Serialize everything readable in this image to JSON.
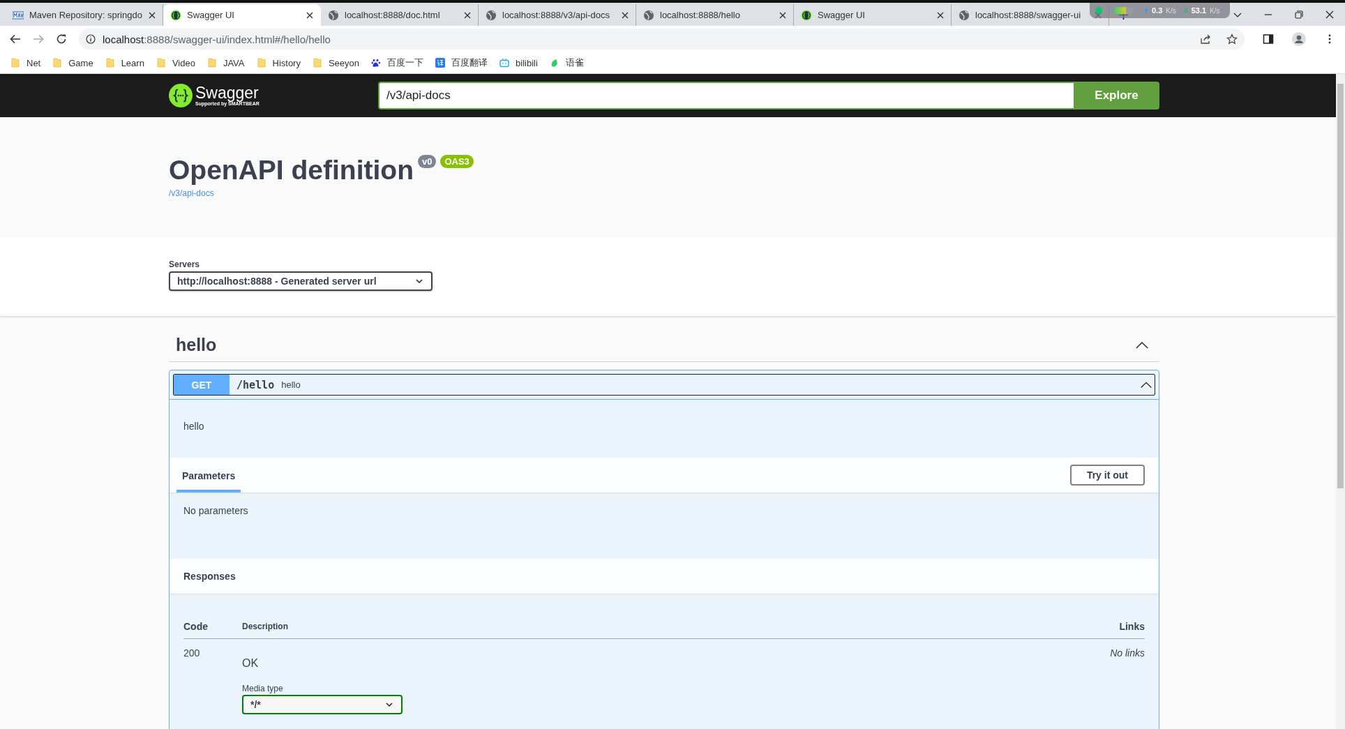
{
  "browser": {
    "tabs": [
      {
        "title": "Maven Repository: springdo",
        "kind": "maven",
        "selected": false
      },
      {
        "title": "Swagger UI",
        "kind": "swagger",
        "selected": true
      },
      {
        "title": "localhost:8888/doc.html",
        "kind": "globe",
        "selected": false
      },
      {
        "title": "localhost:8888/v3/api-docs",
        "kind": "globe",
        "selected": false
      },
      {
        "title": "localhost:8888/hello",
        "kind": "globe",
        "selected": false
      },
      {
        "title": "Swagger UI",
        "kind": "swagger",
        "selected": false
      },
      {
        "title": "localhost:8888/swagger-ui",
        "kind": "globe",
        "selected": false
      }
    ],
    "address_host": "localhost",
    "address_rest": ":8888/swagger-ui/index.html#/hello/hello",
    "bookmarks": [
      {
        "label": "Net",
        "kind": "folder"
      },
      {
        "label": "Game",
        "kind": "folder"
      },
      {
        "label": "Learn",
        "kind": "folder"
      },
      {
        "label": "Video",
        "kind": "folder"
      },
      {
        "label": "JAVA",
        "kind": "folder"
      },
      {
        "label": "History",
        "kind": "folder"
      },
      {
        "label": "Seeyon",
        "kind": "folder"
      },
      {
        "label": "百度一下",
        "kind": "baidu"
      },
      {
        "label": "百度翻译",
        "kind": "translate"
      },
      {
        "label": "bilibili",
        "kind": "bilibili"
      },
      {
        "label": "语雀",
        "kind": "yuque"
      }
    ]
  },
  "net_monitor": {
    "upload": "0.3",
    "upload_unit": "K/s",
    "download": "53.1",
    "download_unit": "K/s"
  },
  "swagger": {
    "logo_text": "Swagger",
    "logo_sub": "Supported by SMARTBEAR",
    "url": "/v3/api-docs",
    "explore": "Explore",
    "title": "OpenAPI definition",
    "version": "v0",
    "oas": "OAS3",
    "spec_link": "/v3/api-docs",
    "servers_label": "Servers",
    "server": "http://localhost:8888 - Generated server url",
    "tags": [
      {
        "name": "hello",
        "expanded": true,
        "operations": [
          {
            "method": "GET",
            "path": "/hello",
            "summary": "hello",
            "expanded": true,
            "description": "hello",
            "parameters_tab": "Parameters",
            "try_button": "Try it out",
            "no_params": "No parameters",
            "responses_title": "Responses",
            "response_columns": [
              "Code",
              "Description",
              "Links"
            ],
            "responses": [
              {
                "code": "200",
                "description": "OK",
                "media_label": "Media type",
                "media": "*/*",
                "links": "No links"
              }
            ]
          }
        ]
      }
    ]
  }
}
